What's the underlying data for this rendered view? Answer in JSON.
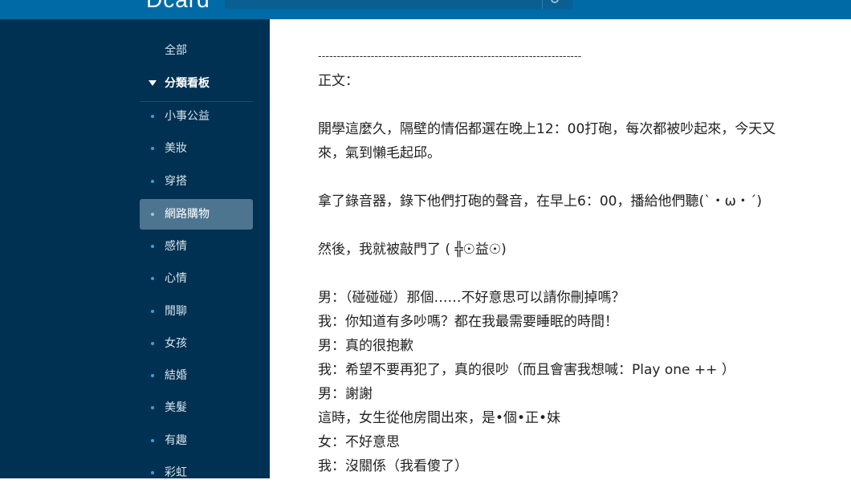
{
  "header": {
    "logo_text": "Dcard"
  },
  "sidebar": {
    "all_label": "全部",
    "group_label": "分類看板",
    "items": [
      {
        "label": "小事公益"
      },
      {
        "label": "美妝"
      },
      {
        "label": "穿搭"
      },
      {
        "label": "網路購物",
        "active": true
      },
      {
        "label": "感情"
      },
      {
        "label": "心情"
      },
      {
        "label": "閒聊"
      },
      {
        "label": "女孩"
      },
      {
        "label": "結婚"
      },
      {
        "label": "美髮"
      },
      {
        "label": "有趣"
      },
      {
        "label": "彩虹"
      }
    ]
  },
  "post": {
    "separator": "----------------------------------------------------------------------",
    "heading": "正文：",
    "lines": [
      "開學這麼久，隔壁的情侶都選在晚上12：00打砲，每次都被吵起來，今天又",
      "來，氣到懶毛起邱。",
      "",
      "拿了錄音器，錄下他們打砲的聲音，在早上6：00，播給他們聽(`・ω・´)",
      "",
      "然後，我就被敲門了 ( ╬☉益☉)",
      "",
      "男：（碰碰碰）那個……不好意思可以請你刪掉嗎？",
      "我：你知道有多吵嗎？都在我最需要睡眠的時間！",
      "男：真的很抱歉",
      "我：希望不要再犯了，真的很吵（而且會害我想喊：Play one ++ ）",
      "男：謝謝",
      "這時，女生從他房間出來，是•個•正•妹",
      "女：不好意思",
      "我：沒關係（我看傻了）"
    ]
  },
  "colors": {
    "topbar": "#006aa6",
    "sidebar": "#003152",
    "active_item": "#4d7590",
    "bullet": "#3aa0de"
  }
}
